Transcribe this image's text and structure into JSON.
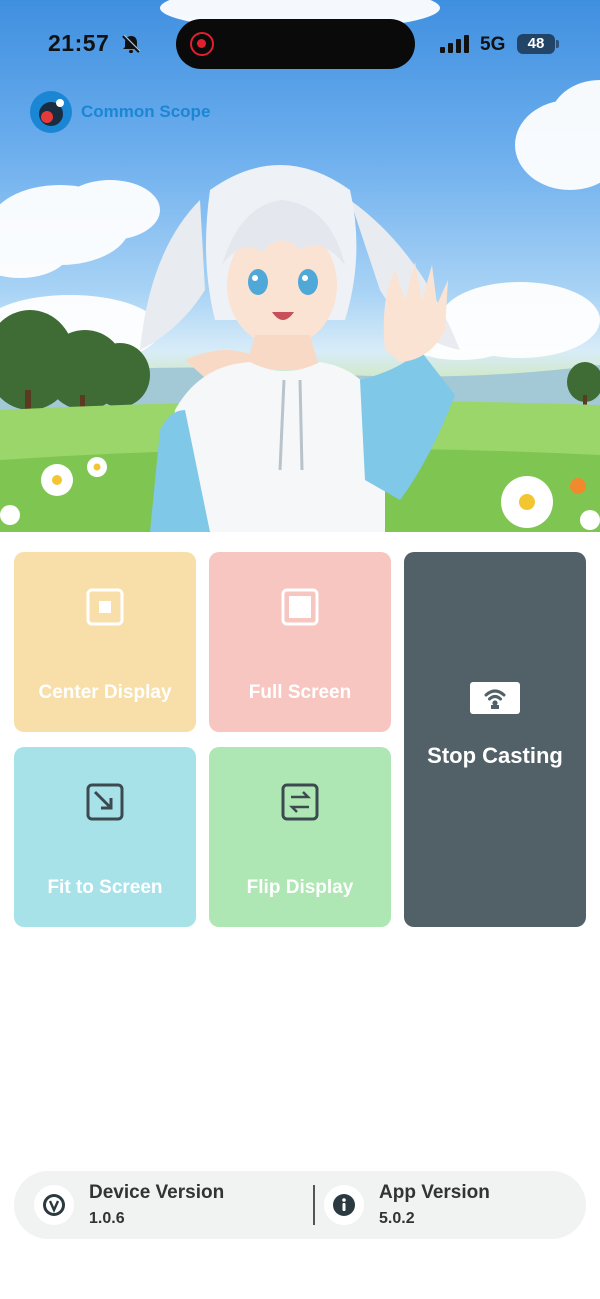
{
  "status_bar": {
    "time": "21:57",
    "network": "5G",
    "battery": "48"
  },
  "brand": {
    "name": "Common Scope"
  },
  "hero": {
    "icon": "anime-girl-illustration"
  },
  "controls": {
    "center_display": "Center Display",
    "full_screen": "Full Screen",
    "fit_to_screen": "Fit to Screen",
    "flip_display": "Flip Display",
    "stop_casting": "Stop Casting"
  },
  "footer": {
    "device_version_label": "Device Version",
    "device_version": "1.0.6",
    "app_version_label": "App Version",
    "app_version": "5.0.2"
  },
  "colors": {
    "center_tile": "#f8dfaa",
    "full_tile": "#f7c6c1",
    "fit_tile": "#a7e2e9",
    "flip_tile": "#aee7b3",
    "stop_tile": "#526068",
    "brand": "#1b86d4"
  }
}
